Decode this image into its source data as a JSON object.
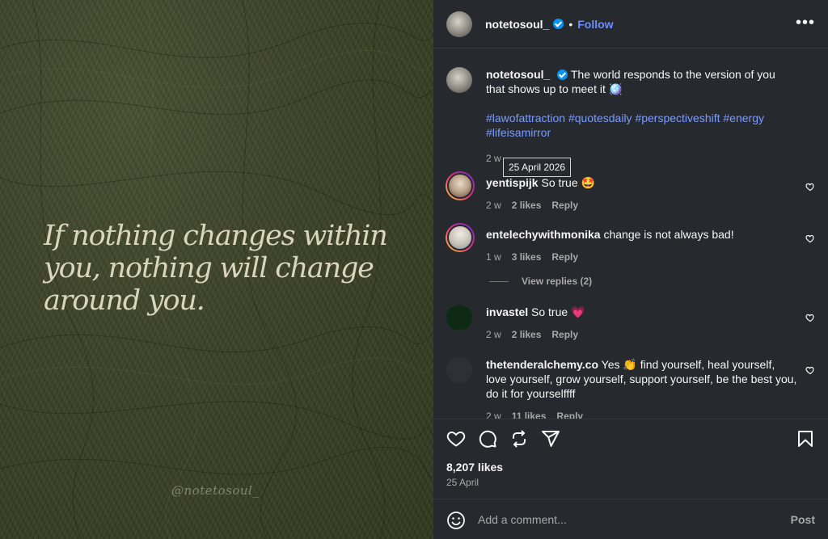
{
  "image": {
    "quote": "If nothing changes within you, nothing will change around you.",
    "watermark": "@notetosoul_"
  },
  "header": {
    "username": "notetosoul_",
    "separator": "•",
    "follow_label": "Follow",
    "more_label": "•••"
  },
  "caption": {
    "username": "notetosoul_",
    "text": "The world responds to the version of you that shows up to meet it 🪩",
    "hashtags": "#lawofattraction #quotesdaily #perspectiveshift #energy #lifeisamirror",
    "age": "2 w"
  },
  "tooltip": "25 April 2026",
  "comments": [
    {
      "username": "yentispijk",
      "text": "So true 🤩",
      "age": "2 w",
      "likes": "2 likes",
      "reply": "Reply"
    },
    {
      "username": "entelechywithmonika",
      "text": "change is not always bad!",
      "age": "1 w",
      "likes": "3 likes",
      "reply": "Reply"
    },
    {
      "username": "invastel",
      "text": "So true 💗",
      "age": "2 w",
      "likes": "2 likes",
      "reply": "Reply"
    },
    {
      "username": "thetenderalchemy.co",
      "text": "Yes 👏 find yourself, heal yourself, love yourself, grow yourself, support yourself, be the best you, do it for yourselffff",
      "age": "2 w",
      "likes": "11 likes",
      "reply": "Reply"
    }
  ],
  "view_replies": "View replies (2)",
  "stats": {
    "likes": "8,207 likes",
    "date": "25 April"
  },
  "add_comment": {
    "placeholder": "Add a comment...",
    "post_label": "Post"
  },
  "colors": {
    "panel_bg": "#262a2f",
    "link_blue": "#6c8cff",
    "hashtag_blue": "#7a9bff",
    "image_green": "#3e4429"
  }
}
